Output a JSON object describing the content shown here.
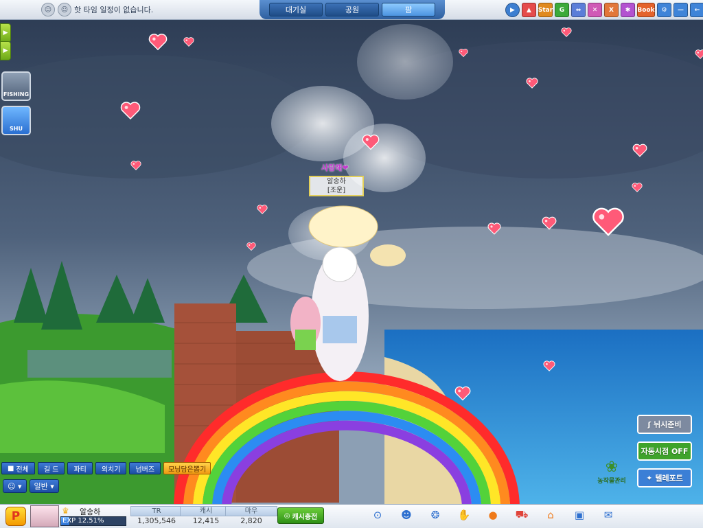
{
  "top": {
    "notice": "핫 타임 일정이 없습니다.",
    "tabs": [
      {
        "label": "대기실",
        "active": false
      },
      {
        "label": "공원",
        "active": false
      },
      {
        "label": "팜",
        "active": true
      }
    ],
    "icons": [
      "play-icon",
      "bag-icon",
      "star-icon",
      "g-icon",
      "link-icon",
      "x-icon",
      "x-icon-2",
      "cog-icon",
      "book-icon",
      "gear-icon",
      "minimize-icon",
      "back-icon"
    ],
    "icon_labels": {
      "star": "Star",
      "g": "G",
      "book": "Book"
    }
  },
  "left": {
    "fishing_label": "FISHING",
    "shu_label": "SHU"
  },
  "character": {
    "speech": "사랑해❤",
    "name_line1": "알송하",
    "name_line2": "[조운]"
  },
  "chat": {
    "tabs": [
      "전체",
      "길 드",
      "파티",
      "외치기",
      "넘버즈"
    ],
    "cash_pick": "모닝담은뽑기",
    "mode": "일반"
  },
  "right": {
    "fishing_ready": "뉘시준비",
    "auto_time": "자동시점 OFF",
    "teleport": "텔레포트",
    "farm_manage": "농작물관리"
  },
  "bottom": {
    "logo": "P",
    "name": "알송하",
    "exp_label": "EXP 12.51%",
    "exp_fraction": 0.1251,
    "stats": [
      {
        "label": "TR",
        "value": "1,305,546"
      },
      {
        "label": "캐시",
        "value": "12,415"
      },
      {
        "label": "마우",
        "value": "2,820"
      }
    ],
    "charge": "캐시충전",
    "icons": [
      "play-circle-icon",
      "friends-icon",
      "paw-icon",
      "handshake-icon",
      "pet-icon",
      "cart-icon",
      "home-icon",
      "briefcase-icon",
      "chat-icon"
    ]
  },
  "colors": {
    "tab_active": "#4c93e0",
    "rbtn_gray": "#7d8aa0",
    "rbtn_green": "#3ea32b",
    "rbtn_blue": "#3b7fd6"
  }
}
